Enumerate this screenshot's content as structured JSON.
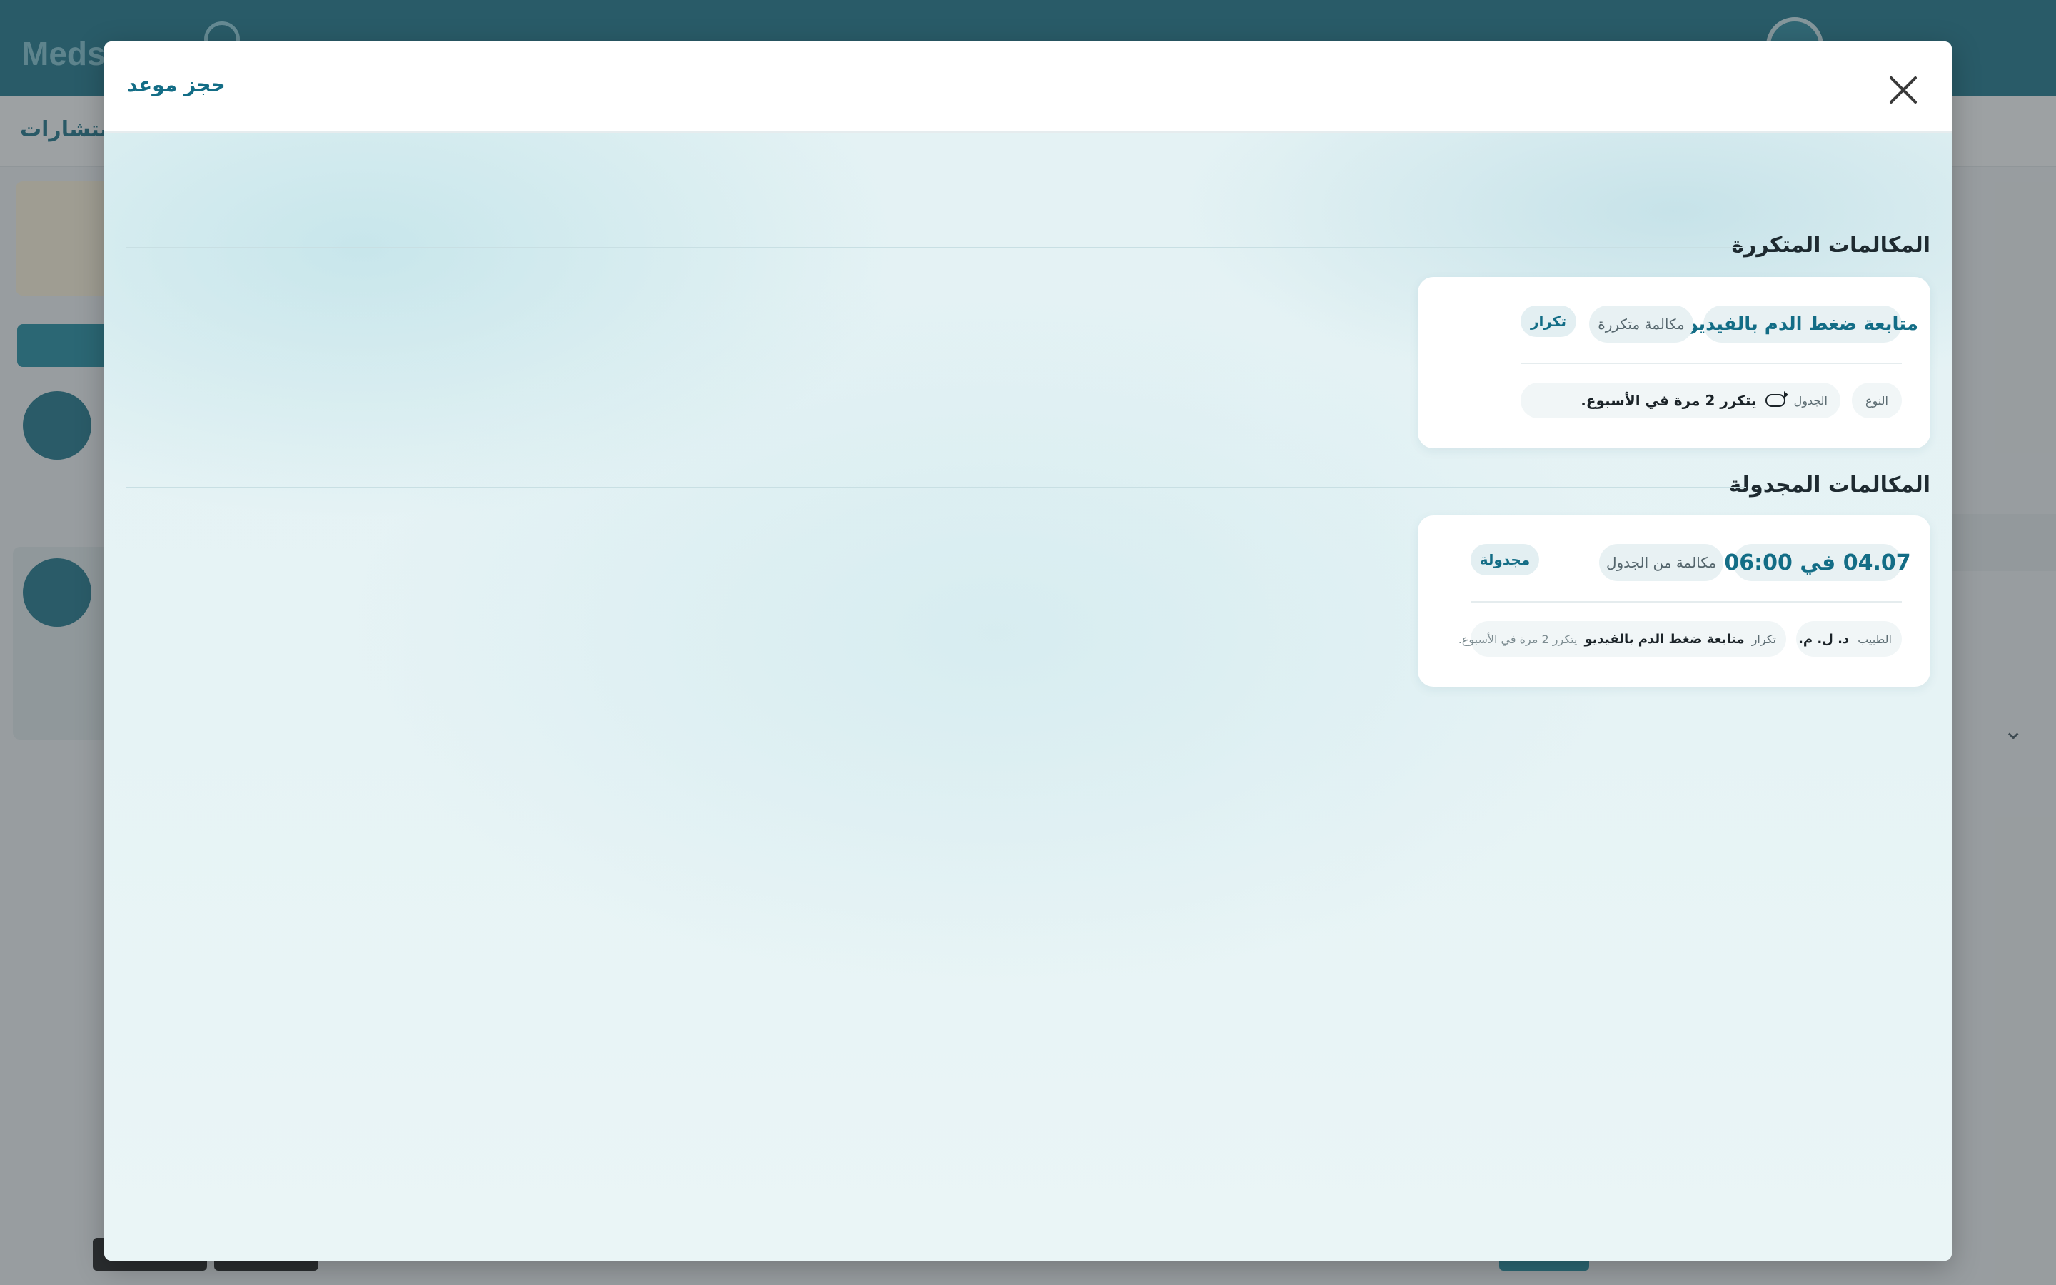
{
  "background": {
    "logo_text": "Meds",
    "subbar_text": "الاستشارات"
  },
  "modal": {
    "title": "حجز موعد",
    "close_label": "×"
  },
  "recurring": {
    "section_title": "المكالمات المتكررة",
    "card": {
      "name": "متابعة ضغط الدم بالفيديو",
      "type_pill": "مكالمة متكررة",
      "badge": "تكرار",
      "type_label": "النوع",
      "schedule_label": "الجدول",
      "schedule_value": "يتكرر 2 مرة في الأسبوع."
    }
  },
  "scheduled": {
    "section_title": "المكالمات المجدولة",
    "card": {
      "datetime": "04.07 في 06:00",
      "type_pill": "مكالمة من الجدول",
      "badge": "مجدولة",
      "doctor_label": "الطبيب",
      "doctor_value": "د. ل. م.",
      "repeat_label": "تكرار",
      "repeat_name": "متابعة ضغط الدم بالفيديو",
      "repeat_detail": "يتكرر 2 مرة في الأسبوع."
    }
  },
  "colors": {
    "accent": "#136d86",
    "header_bg": "#1a7389"
  }
}
